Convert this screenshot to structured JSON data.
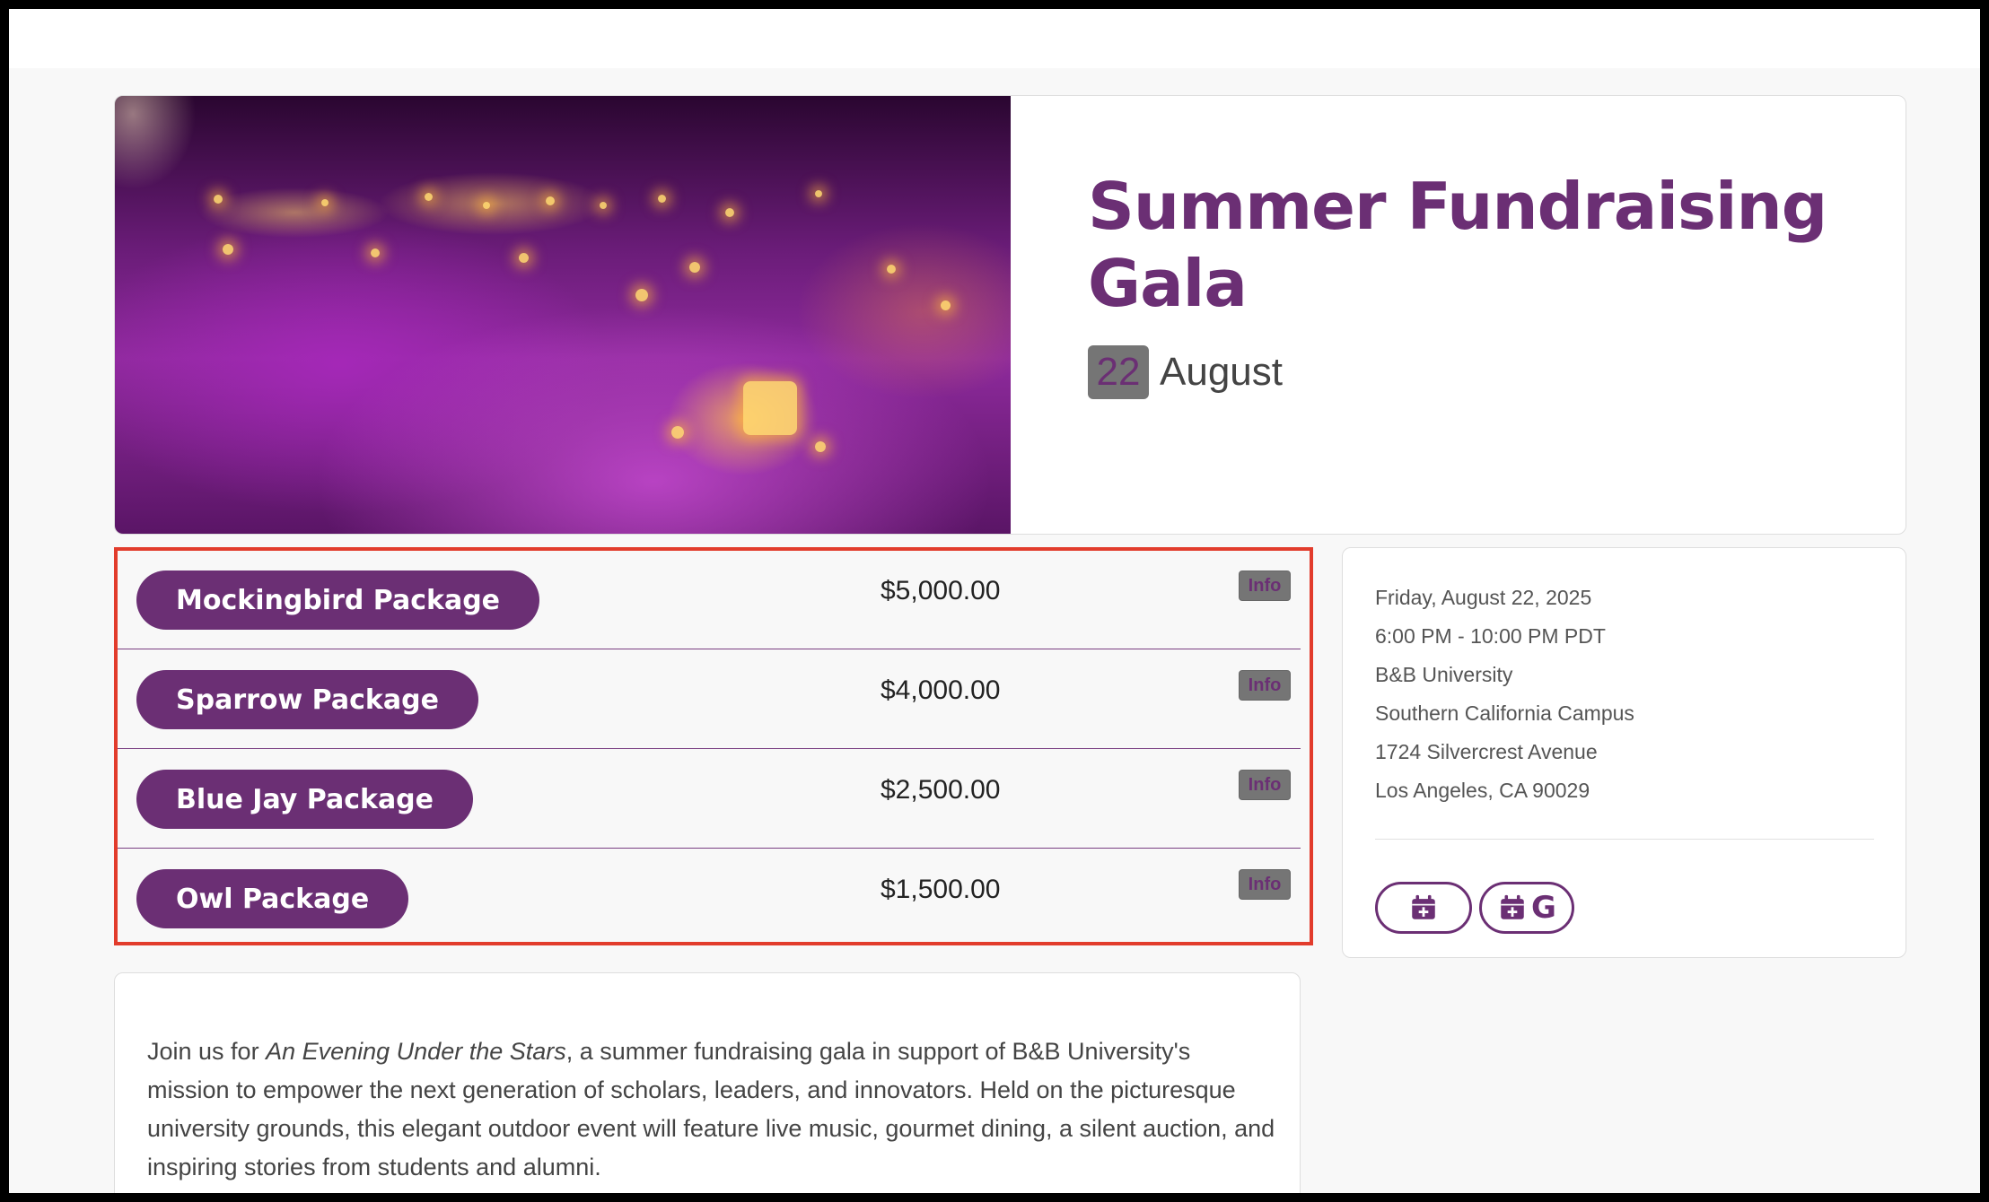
{
  "event": {
    "title": "Summer Fundraising Gala",
    "day": "22",
    "month": "August",
    "hero_image_alt": "Banquet hall with purple lighting and candlelit tables"
  },
  "packages": [
    {
      "name": "Mockingbird Package",
      "price": "$5,000.00",
      "info_label": "Info"
    },
    {
      "name": "Sparrow Package",
      "price": "$4,000.00",
      "info_label": "Info"
    },
    {
      "name": "Blue Jay Package",
      "price": "$2,500.00",
      "info_label": "Info"
    },
    {
      "name": "Owl Package",
      "price": "$1,500.00",
      "info_label": "Info"
    }
  ],
  "details": {
    "date": "Friday, August 22, 2025",
    "time": "6:00 PM - 10:00 PM PDT",
    "venue": "B&B University",
    "campus": "Southern California Campus",
    "street": "1724 Silvercrest Avenue",
    "city": "Los Angeles, CA 90029",
    "calendar_icons": [
      "calendar-plus-icon",
      "google-calendar-icon"
    ]
  },
  "description": {
    "intro": "Join us for ",
    "highlight": "An Evening Under the Stars",
    "body": ", a summer fundraising gala in support of B&B University's mission to empower the next generation of scholars, leaders, and innovators. Held on the picturesque university grounds, this elegant outdoor event will feature live music, gourmet dining, a silent auction, and inspiring stories from students and alumni."
  },
  "colors": {
    "brand": "#6b2f74",
    "highlight_border": "#e23c2c",
    "badge_gray": "#757575"
  }
}
